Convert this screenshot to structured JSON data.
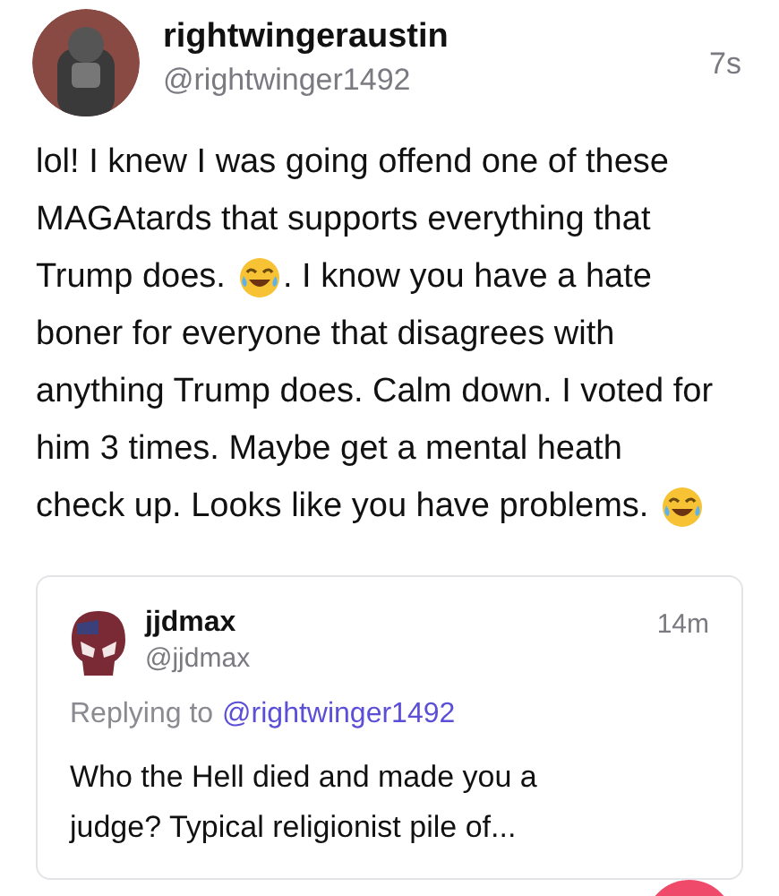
{
  "post": {
    "name": "rightwingeraustin",
    "handle": "@rightwinger1492",
    "time": "7s",
    "body_lines": [
      [
        {
          "kind": "text",
          "text": "lol! I knew I was going offend one of these"
        }
      ],
      [
        {
          "kind": "text",
          "text": "MAGAtards that supports everything that"
        }
      ],
      [
        {
          "kind": "text",
          "text": "Trump does."
        },
        {
          "kind": "emoji"
        },
        {
          "kind": "text",
          "text": ". I know you have a hate"
        }
      ],
      [
        {
          "kind": "text",
          "text": "boner for everyone that disagrees with"
        }
      ],
      [
        {
          "kind": "text",
          "text": "anything Trump does. Calm down. I voted for"
        }
      ],
      [
        {
          "kind": "text",
          "text": "him 3 times. Maybe get a mental heath"
        }
      ],
      [
        {
          "kind": "text",
          "text": "check up. Looks like you have problems."
        },
        {
          "kind": "emoji"
        }
      ]
    ]
  },
  "quote": {
    "name": "jjdmax",
    "handle": "@jjdmax",
    "time": "14m",
    "replying_label": "Replying to",
    "replying_to": "@rightwinger1492",
    "text": "Who the Hell died and made you a judge? Typical religionist pile of..."
  }
}
